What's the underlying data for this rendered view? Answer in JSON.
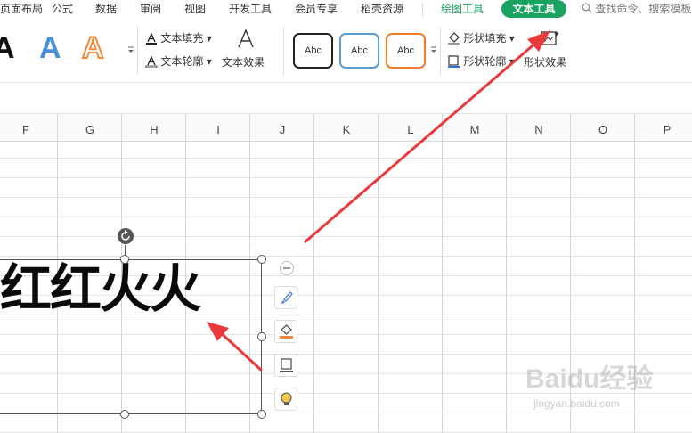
{
  "menu": {
    "items": [
      "页面布局",
      "公式",
      "数据",
      "审阅",
      "视图",
      "开发工具",
      "会员专享",
      "稻壳资源"
    ],
    "drawing_tools": "绘图工具",
    "text_tools": "文本工具",
    "search_placeholder": "查找命令、搜索模板"
  },
  "ribbon": {
    "big_letters": [
      "A",
      "A",
      "A"
    ],
    "text_fill": "文本填充",
    "text_outline": "文本轮廓",
    "text_effect": "文本效果",
    "style_labels": [
      "Abc",
      "Abc",
      "Abc"
    ],
    "shape_fill": "形状填充",
    "shape_outline": "形状轮廓",
    "shape_effect": "形状效果"
  },
  "columns": [
    "F",
    "G",
    "H",
    "I",
    "J",
    "K",
    "L",
    "M",
    "N",
    "O",
    "P"
  ],
  "textbox": {
    "content": "红红火火"
  },
  "watermark": {
    "brand": "Baidu经验",
    "url": "jingyan.baidu.com"
  },
  "colors": {
    "accent_green": "#1aa260",
    "arrow_red": "#e83a3a",
    "style_border_1": "#222222",
    "style_border_2": "#5b9bd5",
    "style_border_3": "#ed7d31",
    "blue_A": "#4a90d9",
    "orange_A": "#f08a3c"
  }
}
